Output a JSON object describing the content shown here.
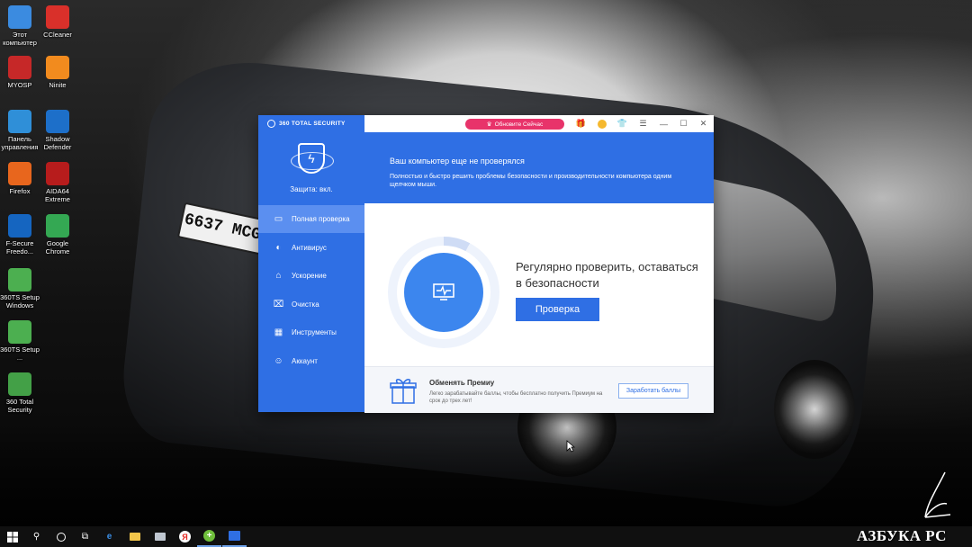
{
  "desktop": {
    "plate_text": "6637 MCG",
    "icons": [
      {
        "label": "Этот компьютер",
        "icon": "computer-icon",
        "color": "#3b8be0"
      },
      {
        "label": "CCleaner",
        "icon": "ccleaner-icon",
        "color": "#d9302a"
      },
      {
        "label": "MYOSP",
        "icon": "myosp-icon",
        "color": "#c62828"
      },
      {
        "label": "Ninite",
        "icon": "ninite-icon",
        "color": "#f28b1e"
      },
      {
        "label": "Панель управления",
        "icon": "control-panel-icon",
        "color": "#2f8fd8"
      },
      {
        "label": "Shadow Defender",
        "icon": "shadow-defender-icon",
        "color": "#1d6fc9"
      },
      {
        "label": "Firefox",
        "icon": "firefox-icon",
        "color": "#e8661d"
      },
      {
        "label": "AIDA64 Extreme",
        "icon": "aida64-icon",
        "color": "#b71c1c"
      },
      {
        "label": "F-Secure Freedo...",
        "icon": "fsecure-icon",
        "color": "#1565c0"
      },
      {
        "label": "Google Chrome",
        "icon": "chrome-icon",
        "color": "#34a853"
      },
      {
        "label": "360TS Setup Windows",
        "icon": "360-setup-icon",
        "color": "#4caf50"
      },
      {
        "label": "360TS Setup ...",
        "icon": "360-setup-icon",
        "color": "#4caf50"
      },
      {
        "label": "360 Total Security",
        "icon": "360ts-icon",
        "color": "#43a047"
      }
    ]
  },
  "app": {
    "brand": "360 TOTAL SECURITY",
    "upgrade_label": "Обновите Сейчас",
    "protection_label": "Защита: вкл.",
    "nav": [
      {
        "label": "Полная проверка",
        "icon": "monitor-icon",
        "active": true
      },
      {
        "label": "Антивирус",
        "icon": "antivirus-icon",
        "active": false
      },
      {
        "label": "Ускорение",
        "icon": "rocket-icon",
        "active": false
      },
      {
        "label": "Очистка",
        "icon": "broom-icon",
        "active": false
      },
      {
        "label": "Инструменты",
        "icon": "tools-icon",
        "active": false
      },
      {
        "label": "Аккаунт",
        "icon": "account-icon",
        "active": false
      }
    ],
    "banner_title": "Ваш компьютер еще не проверялся",
    "banner_desc": "Полностью и быстро решить проблемы безопасности и производительности компьютера одним щелчком мыши.",
    "check_title": "Регулярно проверить, оставаться в безопасности",
    "check_button": "Проверка",
    "footer_title": "Обменять Премиу",
    "footer_desc": "Легко зарабатывайте баллы, чтобы бесплатно получить Премиум на срок до трех лет!",
    "earn_button": "Заработать баллы",
    "colors": {
      "primary": "#2f6fe4",
      "accent_pink": "#e8336a"
    }
  },
  "taskbar": {
    "items": [
      "start-icon",
      "search-icon",
      "cortana-icon",
      "task-view-icon",
      "edge-icon",
      "file-explorer-icon",
      "photos-icon",
      "yandex-icon",
      "360-setup-icon",
      "360ts-icon"
    ]
  },
  "watermark": "АЗБУКА PC"
}
